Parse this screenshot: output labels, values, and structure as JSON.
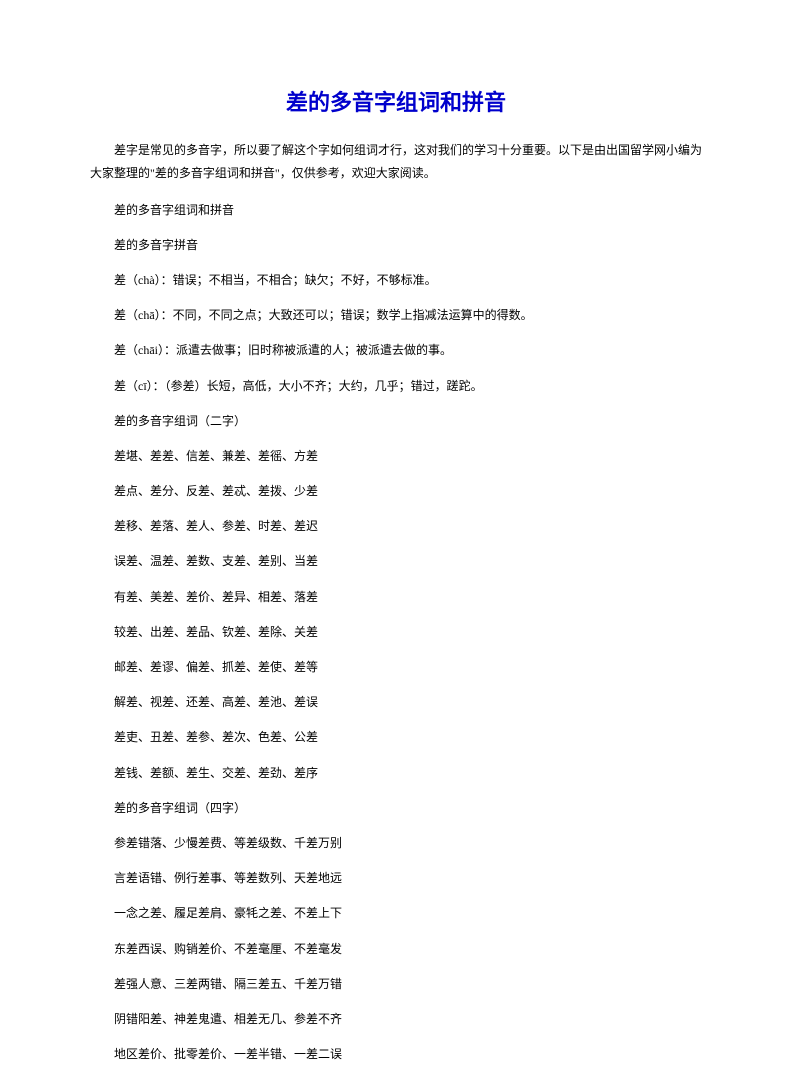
{
  "title": "差的多音字组词和拼音",
  "intro": "差字是常见的多音字，所以要了解这个字如何组词才行，这对我们的学习十分重要。以下是由出国留学网小编为大家整理的\"差的多音字组词和拼音\"，仅供参考，欢迎大家阅读。",
  "lines": [
    "差的多音字组词和拼音",
    "差的多音字拼音",
    "差（chà）：错误；不相当，不相合；缺欠；不好，不够标准。",
    "差（chā）：不同，不同之点；大致还可以；错误；数学上指减法运算中的得数。",
    "差（chāi）：派遣去做事；旧时称被派遣的人；被派遣去做的事。",
    "差（cī）：（参差）长短，高低，大小不齐；大约，几乎；错过，蹉跎。",
    "差的多音字组词（二字）",
    "差堪、差差、信差、兼差、差徭、方差",
    "差点、差分、反差、差忒、差拨、少差",
    "差移、差落、差人、参差、时差、差迟",
    "误差、温差、差数、支差、差别、当差",
    "有差、美差、差价、差异、相差、落差",
    "较差、出差、差品、钦差、差除、关差",
    "邮差、差谬、偏差、抓差、差使、差等",
    "解差、视差、还差、高差、差池、差误",
    "差吏、丑差、差参、差次、色差、公差",
    "差钱、差额、差生、交差、差劲、差序",
    "差的多音字组词（四字）",
    "参差错落、少慢差费、等差级数、千差万别",
    "言差语错、例行差事、等差数列、天差地远",
    "一念之差、履足差肩、豪牦之差、不差上下",
    "东差西误、购销差价、不差毫厘、不差毫发",
    "差强人意、三差两错、隔三差五、千差万错",
    "阴错阳差、神差鬼遣、相差无几、参差不齐",
    "地区差价、批零差价、一差半错、一差二误"
  ]
}
